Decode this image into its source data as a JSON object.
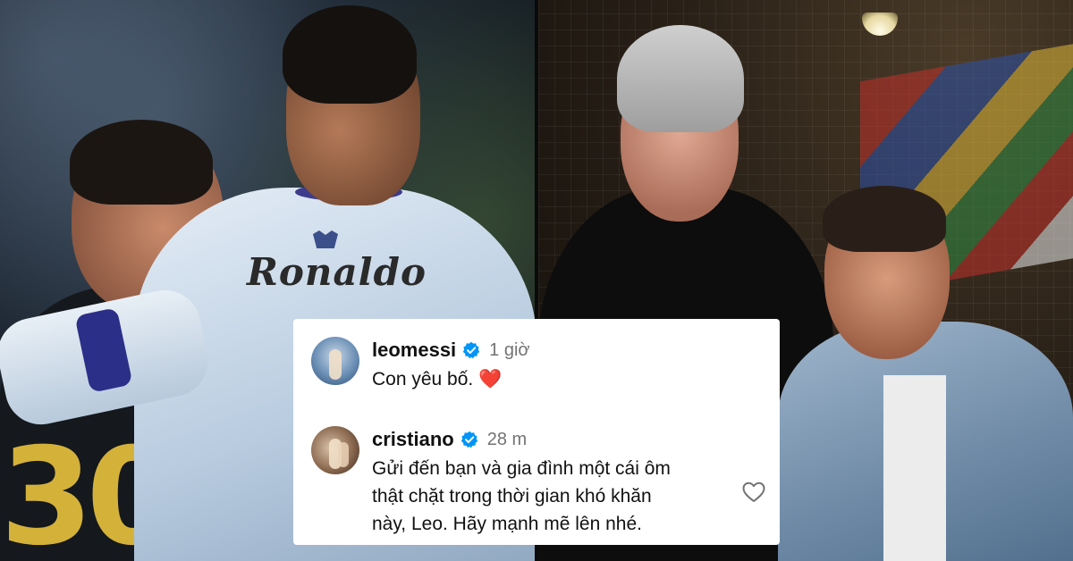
{
  "comments": [
    {
      "username": "leomessi",
      "verified": true,
      "time": "1 giờ",
      "text": "Con yêu bố.",
      "emoji": "❤️"
    },
    {
      "username": "cristiano",
      "verified": true,
      "time": "28 m",
      "text_lines": [
        "Gửi đến bạn và gia đình một cái ôm",
        "thật chặt trong thời gian khó khăn",
        "này, Leo. Hãy mạnh mẽ lên nhé."
      ]
    }
  ],
  "photo_left": {
    "shirt_name": "Ronaldo",
    "shirt_number": "30"
  },
  "icons": {
    "verified": "verified-badge-icon",
    "like": "heart-outline-icon"
  },
  "colors": {
    "verified": "#0095f6",
    "heart": "#e0245e",
    "muted": "#737373"
  }
}
